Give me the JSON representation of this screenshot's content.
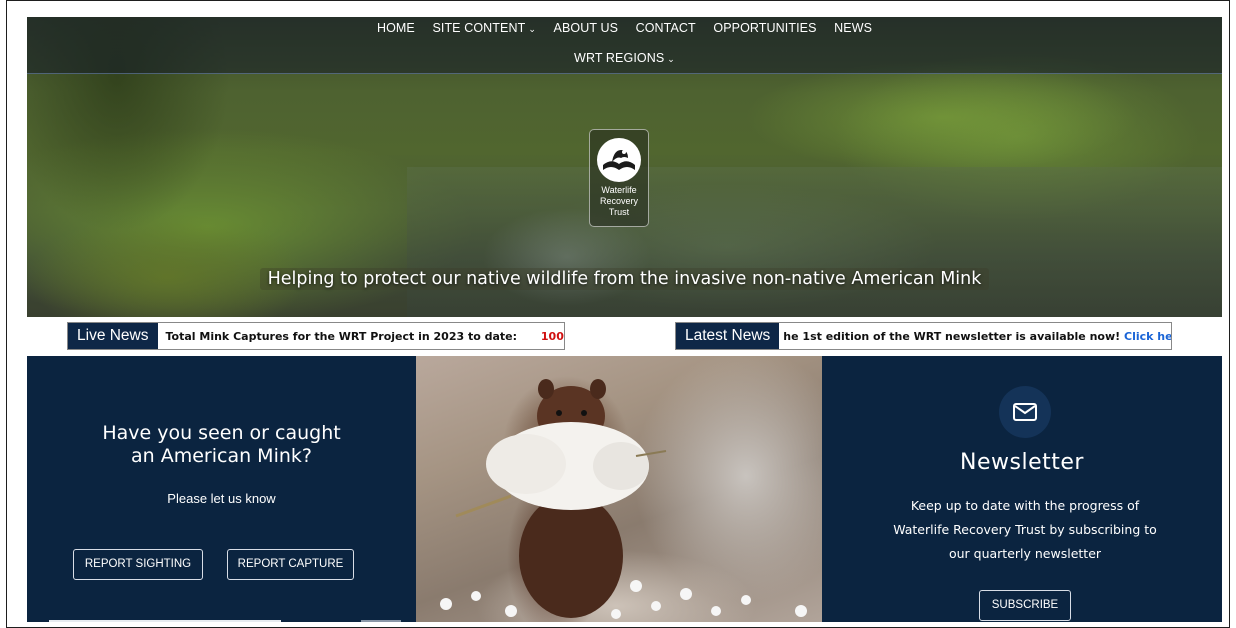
{
  "nav": {
    "row1": [
      {
        "label": "HOME",
        "has_dropdown": false
      },
      {
        "label": "SITE CONTENT",
        "has_dropdown": true
      },
      {
        "label": "ABOUT US",
        "has_dropdown": false
      },
      {
        "label": "CONTACT",
        "has_dropdown": false
      },
      {
        "label": "OPPORTUNITIES",
        "has_dropdown": false
      },
      {
        "label": "NEWS",
        "has_dropdown": false
      }
    ],
    "row2": [
      {
        "label": "WRT REGIONS",
        "has_dropdown": true
      }
    ],
    "dropdown_glyph": "⌄"
  },
  "logo": {
    "line1": "Waterlife",
    "line2": "Recovery",
    "line3": "Trust"
  },
  "hero": {
    "tagline": "Helping to protect our native wildlife from the invasive non-native American Mink"
  },
  "live_news": {
    "label": "Live News",
    "text": "Total Mink Captures for the WRT Project in 2023 to date:",
    "count": "100",
    "separator": "|"
  },
  "latest_news": {
    "label": "Latest News",
    "text": "he 1st edition of the WRT newsletter is available now!",
    "link": "Click here"
  },
  "report": {
    "title_line1": "Have you seen or caught",
    "title_line2": "an American Mink?",
    "subtitle": "Please let us know",
    "sighting_button": "REPORT SIGHTING",
    "capture_button": "REPORT CAPTURE"
  },
  "newsletter": {
    "icon": "envelope-icon",
    "title": "Newsletter",
    "line1": "Keep up to date with the progress of",
    "line2": "Waterlife Recovery Trust by subscribing to",
    "line3": "our quarterly newsletter",
    "button": "SUBSCRIBE"
  },
  "colors": {
    "navy": "#0b2440",
    "live_count": "#d01010",
    "link": "#1a64d6"
  }
}
